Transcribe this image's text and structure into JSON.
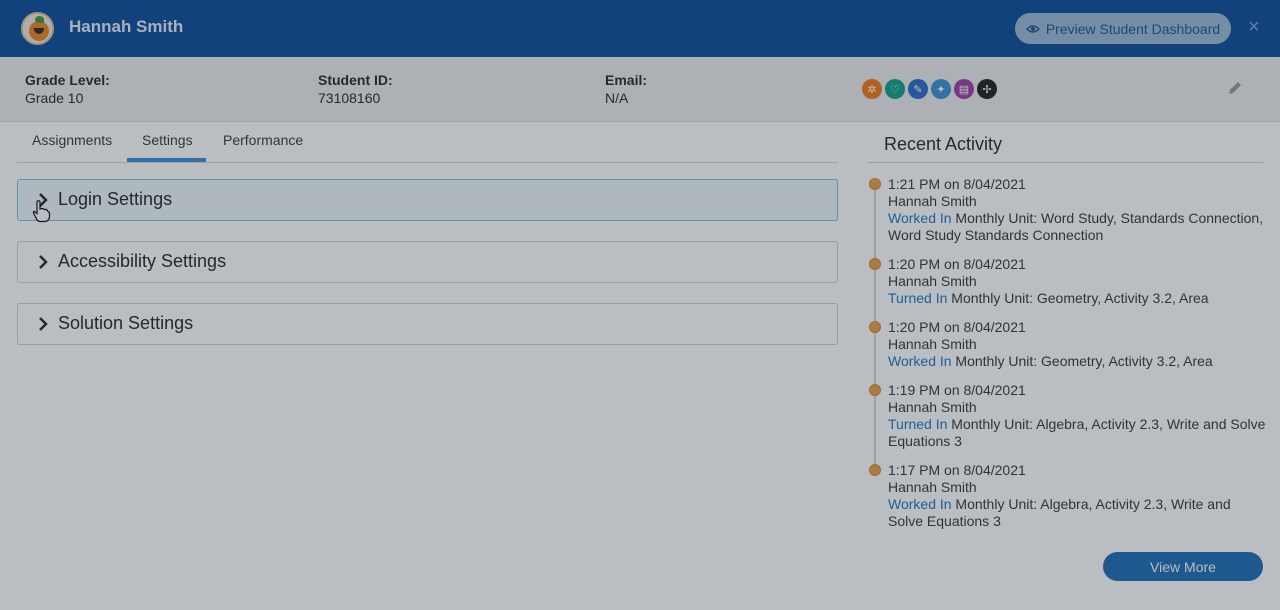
{
  "header": {
    "student_name": "Hannah Smith",
    "preview_label": "Preview Student Dashboard",
    "close_symbol": "×"
  },
  "info": {
    "grade_label": "Grade Level:",
    "grade_value": "Grade 10",
    "id_label": "Student ID:",
    "id_value": "73108160",
    "email_label": "Email:",
    "email_value": "N/A",
    "badges": [
      {
        "icon": "sun-icon",
        "color": "#ef7d1a",
        "glyph": "✲"
      },
      {
        "icon": "heart-icon",
        "color": "#14a38b",
        "glyph": "♡"
      },
      {
        "icon": "feather-icon",
        "color": "#2c6fc9",
        "glyph": "✎"
      },
      {
        "icon": "person-icon",
        "color": "#3b95d6",
        "glyph": "✦"
      },
      {
        "icon": "books-icon",
        "color": "#a13fa8",
        "glyph": "▤"
      },
      {
        "icon": "compass-icon",
        "color": "#232323",
        "glyph": "✢"
      }
    ]
  },
  "tabs": {
    "assignments": "Assignments",
    "settings": "Settings",
    "performance": "Performance"
  },
  "accordions": {
    "login": "Login Settings",
    "accessibility": "Accessibility Settings",
    "solution": "Solution Settings"
  },
  "recent_activity": {
    "title": "Recent Activity",
    "items": [
      {
        "time": "1:21 PM on 8/04/2021",
        "name": "Hannah Smith",
        "action": "Worked In",
        "detail": " Monthly Unit: Word Study, Standards Connection, Word Study Standards Connection"
      },
      {
        "time": "1:20 PM on 8/04/2021",
        "name": "Hannah Smith",
        "action": "Turned In",
        "detail": " Monthly Unit: Geometry, Activity 3.2, Area"
      },
      {
        "time": "1:20 PM on 8/04/2021",
        "name": "Hannah Smith",
        "action": "Worked In",
        "detail": " Monthly Unit: Geometry, Activity 3.2, Area"
      },
      {
        "time": "1:19 PM on 8/04/2021",
        "name": "Hannah Smith",
        "action": "Turned In",
        "detail": " Monthly Unit: Algebra, Activity 2.3, Write and Solve Equations 3"
      },
      {
        "time": "1:17 PM on 8/04/2021",
        "name": "Hannah Smith",
        "action": "Worked In",
        "detail": " Monthly Unit: Algebra, Activity 2.3, Write and Solve Equations 3"
      }
    ],
    "view_more": "View More"
  }
}
